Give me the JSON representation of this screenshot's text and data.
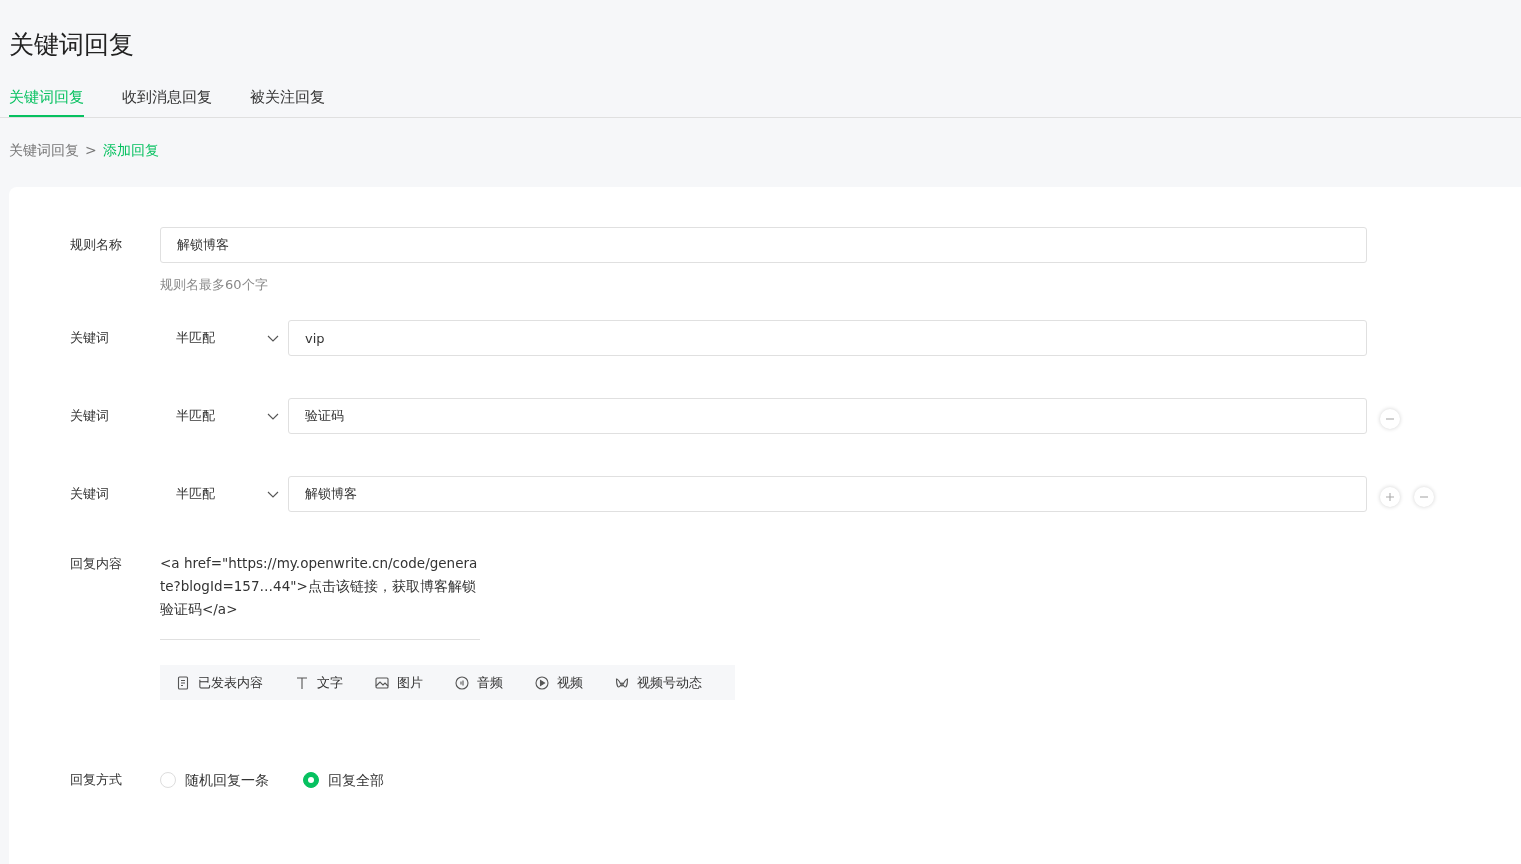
{
  "page_title": "关键词回复",
  "tabs": [
    {
      "label": "关键词回复",
      "selected": true
    },
    {
      "label": "收到消息回复",
      "selected": false
    },
    {
      "label": "被关注回复",
      "selected": false
    }
  ],
  "breadcrumb": {
    "items": [
      {
        "label": "关键词回复",
        "selected": false
      },
      {
        "label": "添加回复",
        "selected": true
      }
    ],
    "separator": ">"
  },
  "rule_name": {
    "label": "规则名称",
    "value": "解锁博客",
    "hint": "规则名最多60个字"
  },
  "keywords": [
    {
      "label": "关键词",
      "match": "半匹配",
      "value": "vip",
      "can_add": false,
      "can_remove": false
    },
    {
      "label": "关键词",
      "match": "半匹配",
      "value": "验证码",
      "can_add": false,
      "can_remove": true
    },
    {
      "label": "关键词",
      "match": "半匹配",
      "value": "解锁博客",
      "can_add": true,
      "can_remove": true
    }
  ],
  "reply_content": {
    "label": "回复内容",
    "text": "<a href=\"https://my.openwrite.cn/code/generate?blogId=157…44\">点击该链接，获取博客解锁验证码</a>"
  },
  "toolbar": [
    {
      "label": "已发表内容",
      "kind": "article"
    },
    {
      "label": "文字",
      "kind": "text"
    },
    {
      "label": "图片",
      "kind": "image"
    },
    {
      "label": "音频",
      "kind": "audio"
    },
    {
      "label": "视频",
      "kind": "video"
    },
    {
      "label": "视频号动态",
      "kind": "channel"
    }
  ],
  "reply_mode": {
    "label": "回复方式",
    "options": [
      {
        "label": "随机回复一条",
        "selected": false
      },
      {
        "label": "回复全部",
        "selected": true
      }
    ]
  }
}
